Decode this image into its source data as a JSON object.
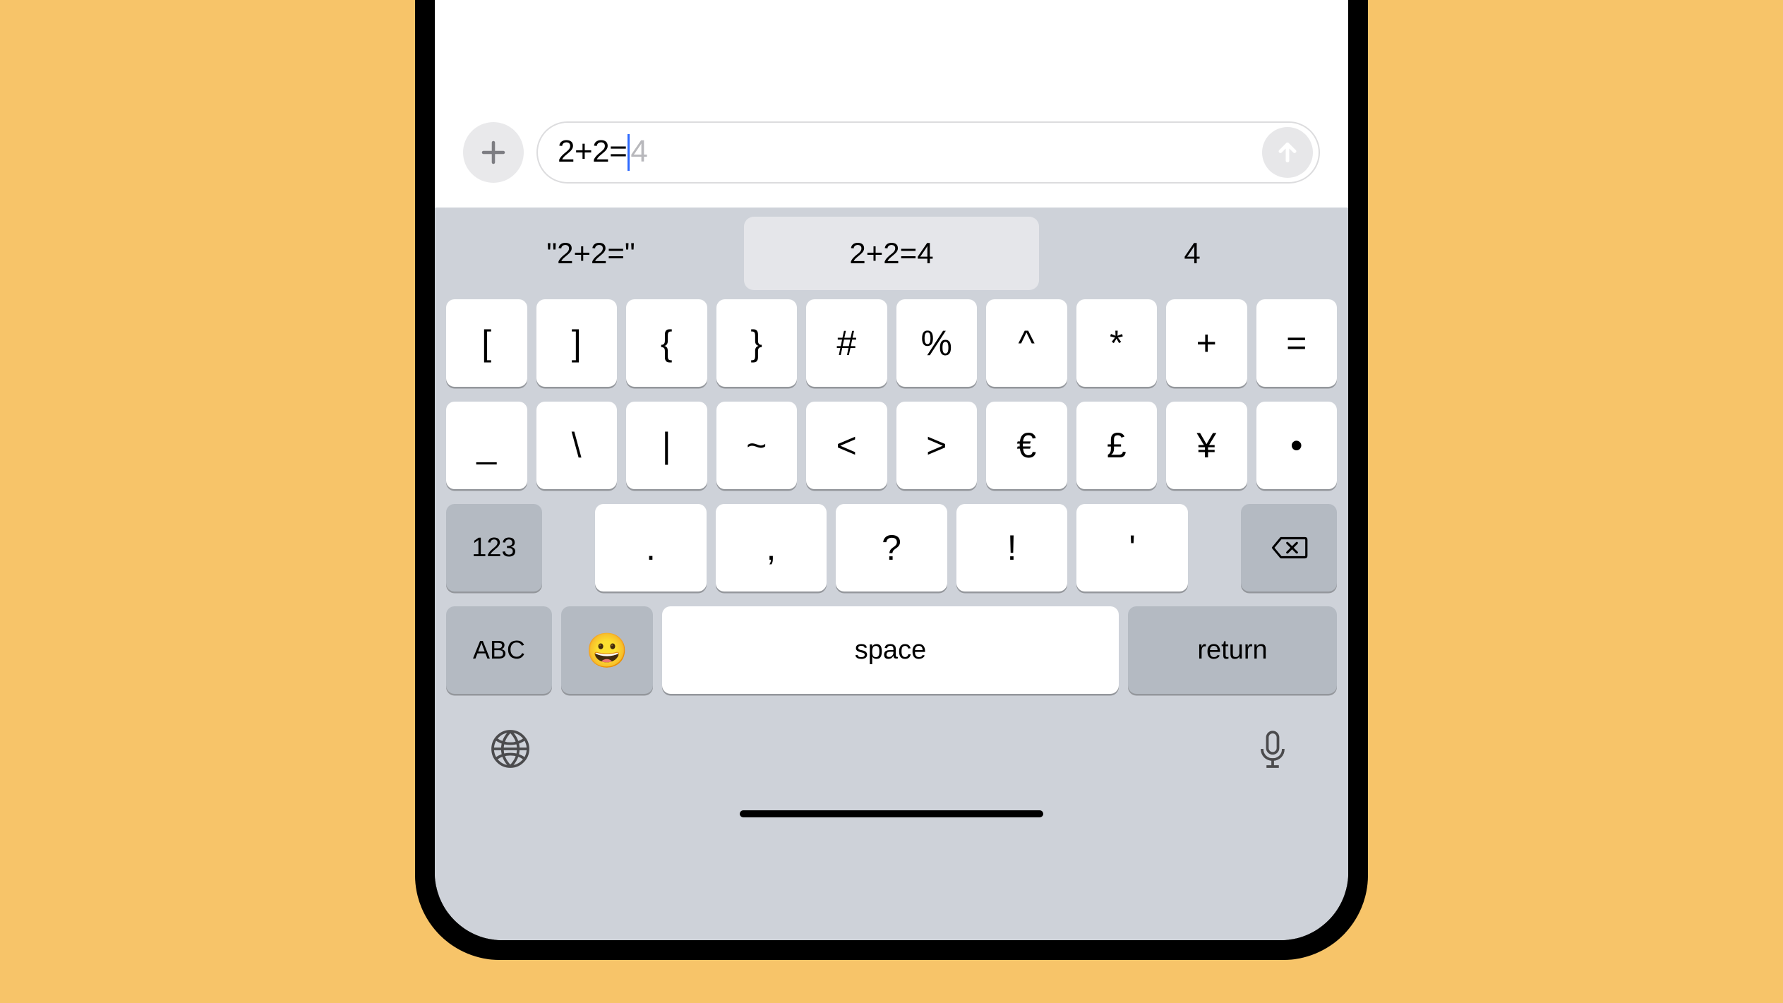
{
  "compose": {
    "typed": "2+2=",
    "suggestionGhost": "4"
  },
  "predictions": {
    "left": "\"2+2=\"",
    "center": "2+2=4",
    "right": "4"
  },
  "keys": {
    "row1": [
      "[",
      "]",
      "{",
      "}",
      "#",
      "%",
      "^",
      "*",
      "+",
      "="
    ],
    "row2": [
      "_",
      "\\",
      "|",
      "~",
      "<",
      ">",
      "€",
      "£",
      "¥",
      "•"
    ],
    "row3": {
      "numToggle": "123",
      "punct": [
        ".",
        ",",
        "?",
        "!",
        "'"
      ]
    },
    "row4": {
      "abc": "ABC",
      "space": "space",
      "return": "return"
    }
  }
}
